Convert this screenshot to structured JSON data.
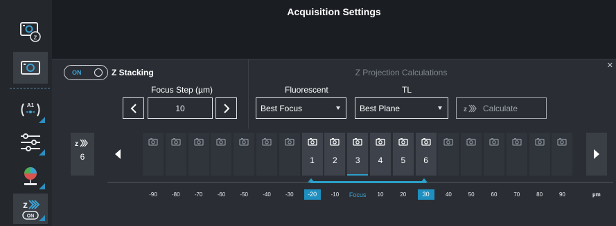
{
  "header": {
    "title": "Acquisition Settings"
  },
  "rail": {
    "items": [
      {
        "name": "camera-z-icon"
      },
      {
        "name": "camera-icon"
      },
      {
        "name": "autofocus-a1-icon"
      },
      {
        "name": "sliders-icon"
      },
      {
        "name": "balloon-icon"
      },
      {
        "name": "z-stack-on-icon",
        "badge": "ON"
      }
    ]
  },
  "zstack": {
    "toggle_label": "ON",
    "toggle_state": true,
    "label": "Z Stacking",
    "focus_step_label": "Focus Step (µm)",
    "focus_step_value": "10"
  },
  "projection": {
    "title": "Z Projection Calculations",
    "fluorescent_label": "Fluorescent",
    "fluorescent_value": "Best Focus",
    "tl_label": "TL",
    "tl_value": "Best Plane",
    "calculate_label": "Calculate"
  },
  "strip": {
    "slice_count": "6",
    "slices": [
      {
        "num": "",
        "selected": false
      },
      {
        "num": "",
        "selected": false
      },
      {
        "num": "",
        "selected": false
      },
      {
        "num": "",
        "selected": false
      },
      {
        "num": "",
        "selected": false
      },
      {
        "num": "",
        "selected": false
      },
      {
        "num": "",
        "selected": false
      },
      {
        "num": "1",
        "selected": true
      },
      {
        "num": "2",
        "selected": true
      },
      {
        "num": "3",
        "selected": true,
        "current": true
      },
      {
        "num": "4",
        "selected": true
      },
      {
        "num": "5",
        "selected": true
      },
      {
        "num": "6",
        "selected": true
      },
      {
        "num": "",
        "selected": false
      },
      {
        "num": "",
        "selected": false
      },
      {
        "num": "",
        "selected": false
      },
      {
        "num": "",
        "selected": false
      },
      {
        "num": "",
        "selected": false
      },
      {
        "num": "",
        "selected": false
      }
    ]
  },
  "axis": {
    "ticks": [
      "-90",
      "-80",
      "-70",
      "-60",
      "-50",
      "-40",
      "-30",
      "-20",
      "-10",
      "Focus",
      "10",
      "20",
      "30",
      "40",
      "50",
      "60",
      "70",
      "80",
      "90"
    ],
    "range_start": "-20",
    "range_end": "30",
    "unit": "µm"
  },
  "colors": {
    "accent": "#2ba0c8",
    "panel": "#2a2e34",
    "rail": "#24272c"
  }
}
